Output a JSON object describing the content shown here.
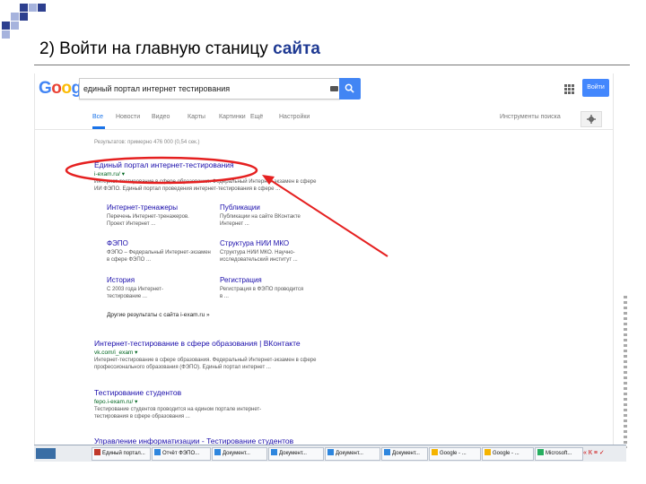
{
  "slide": {
    "title_prefix": "2) Войти на главную станицу ",
    "title_highlight": "сайта"
  },
  "colors": {
    "deco_blue": "#2d3f8f",
    "deco_light": "#a6b3dd",
    "annotation_red": "#e52020",
    "link_blue": "#1a0dab",
    "url_green": "#006621",
    "google_blue": "#4285f4"
  },
  "google": {
    "logo": [
      "G",
      "o",
      "o",
      "g",
      "l",
      "e"
    ],
    "logo_colors": [
      "#4285f4",
      "#ea4335",
      "#fbbc05",
      "#4285f4",
      "#34a853",
      "#ea4335"
    ],
    "query": "единый портал интернет тестирования",
    "signin_label": "Войти",
    "tabs": [
      "Все",
      "Новости",
      "Видео",
      "Карты",
      "Картинки",
      "Ещё",
      "Настройки"
    ],
    "tools_label": "Инструменты поиска",
    "meta": "Результатов: примерно 476 000 (0,54 сек.)"
  },
  "results": [
    {
      "title": "Единый портал интернет-тестирования",
      "url": "i-exam.ru/ ▾",
      "snippet": [
        "Интернет-тестирование в сфере образования. Федеральный Интернет-экзамен в сфере",
        "ИИ ФЭПО. Единый портал проведения интернет-тестирования в сфере ..."
      ],
      "sitelinks": [
        {
          "title": "Интернет-тренажеры",
          "snippet": [
            "Перечень Интернет-тренажеров.",
            "Проект Интернет ..."
          ]
        },
        {
          "title": "Публикации",
          "snippet": [
            "Публикации на сайте ВКонтакте",
            "Интернет ..."
          ]
        },
        {
          "title": "ФЭПО",
          "snippet": [
            "ФЭПО – Федеральный Интернет-экзамен",
            "в сфере ФЭПО ..."
          ]
        },
        {
          "title": "Структура НИИ МКО",
          "snippet": [
            "Структура НИИ МКО. Научно-",
            "исследовательский институт ..."
          ]
        },
        {
          "title": "История",
          "snippet": [
            "С 2003 года Интернет-",
            "тестирование ..."
          ]
        },
        {
          "title": "Регистрация",
          "snippet": [
            "Регистрация в ФЭПО проводится",
            "в ..."
          ]
        }
      ],
      "more_link": "Другие результаты с сайта i-exam.ru »"
    },
    {
      "title": "Интернет-тестирование в сфере образования | ВКонтакте",
      "url": "vk.com/i_exam ▾",
      "snippet": [
        "Интернет-тестирование в сфере образования. Федеральный Интернет-экзамен в сфере",
        "профессионального образования (ФЭПО). Единый портал интернет ..."
      ]
    },
    {
      "title": "Тестирование студентов",
      "url": "fepo.i-exam.ru/ ▾",
      "snippet": [
        "Тестирование студентов проводится на едином портале интернет-",
        "тестирования в сфере образования ..."
      ]
    },
    {
      "title": "Управление информатизации - Тестирование студентов",
      "url": "",
      "snippet": []
    }
  ],
  "taskbar": {
    "items": [
      "Единый портал...",
      "Отчёт ФЭПО...",
      "Документ...",
      "Документ...",
      "Документ...",
      "Документ...",
      "Google - ...",
      "Google - ...",
      "Microsoft..."
    ],
    "tray": "« К ≡ ✓"
  }
}
